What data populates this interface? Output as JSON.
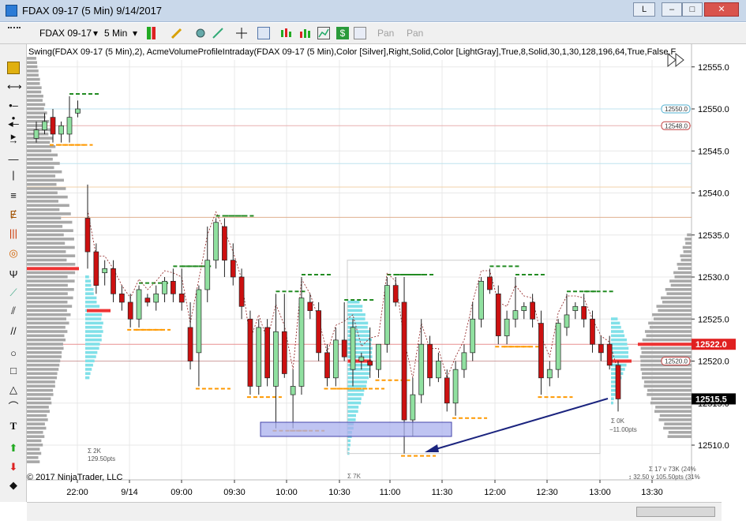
{
  "window": {
    "title": "FDAX 09-17 (5 Min)  9/14/2017",
    "btn_l": "L",
    "btn_min": "–",
    "btn_max": "□",
    "btn_close": "✕"
  },
  "toolbar": {
    "instrument": "FDAX 09-17",
    "period": "5 Min",
    "pan1": "Pan",
    "pan2": "Pan"
  },
  "chart_label": "Swing(FDAX 09-17 (5 Min),2), AcmeVolumeProfileIntraday(FDAX 09-17 (5 Min),Color [Silver],Right,Solid,Color [LightGray],True,8,Solid,30,1,30,128,196,64,True,False,F",
  "copyright": "© 2017 NinjaTrader, LLC",
  "annotations": {
    "mid_sigma": "Σ 7K",
    "left_sigma": "Σ 2K",
    "left_pts": "129.50pts",
    "right_sigma": "Σ 0K",
    "right_pts": "−11.00pts",
    "br_line1": "Σ 17 v 73K (24%",
    "br_line2": "↕ 32.50 v 105.50pts (31%"
  },
  "colors": {
    "up": "#90e0a0",
    "down": "#cc1010",
    "swing_high": "#228b22",
    "swing_low": "#ff9900",
    "profile": "#aaaaaa",
    "profile_cyan": "#80e0e8",
    "poc": "#ee3333",
    "arrow": "#1a237e",
    "box": "#aab0ee"
  },
  "chart_data": {
    "type": "candlestick",
    "instrument": "FDAX 09-17",
    "interval": "5 Min",
    "date": "9/14/2017",
    "y_ticks": [
      12510.0,
      12515.0,
      12520.0,
      12525.0,
      12530.0,
      12535.0,
      12540.0,
      12545.0,
      12550.0,
      12555.0
    ],
    "ylim": [
      12506.0,
      12557.0
    ],
    "x_ticks": [
      "22:00",
      "9/14",
      "09:00",
      "09:30",
      "10:00",
      "10:30",
      "11:00",
      "11:30",
      "12:00",
      "12:30",
      "13:00",
      "13:30"
    ],
    "price_markers": [
      {
        "label": "12550.0",
        "value": 12550.0,
        "color": "#50b0d0"
      },
      {
        "label": "12548.0",
        "value": 12548.0,
        "color": "#c04040"
      },
      {
        "label": "12522.0",
        "value": 12522.0,
        "color": "#e02020"
      },
      {
        "label": "12520.0",
        "value": 12520.0,
        "color": "#c04040"
      },
      {
        "label": "12515.5",
        "value": 12515.5,
        "color": "#000000"
      }
    ],
    "candles": [
      {
        "o": 12546.5,
        "h": 12548.5,
        "l": 12546.0,
        "c": 12547.5
      },
      {
        "o": 12547.5,
        "h": 12549.5,
        "l": 12547.0,
        "c": 12548.5
      },
      {
        "o": 12549.0,
        "h": 12550.0,
        "l": 12546.0,
        "c": 12547.0
      },
      {
        "o": 12547.0,
        "h": 12548.5,
        "l": 12546.0,
        "c": 12548.0
      },
      {
        "o": 12547.0,
        "h": 12551.5,
        "l": 12546.0,
        "c": 12549.0
      },
      {
        "o": 12549.5,
        "h": 12551.0,
        "l": 12549.0,
        "c": 12550.0
      },
      {
        "o": 12537.0,
        "h": 12541.0,
        "l": 12531.0,
        "c": 12533.0
      },
      {
        "o": 12533.0,
        "h": 12534.0,
        "l": 12528.0,
        "c": 12529.0
      },
      {
        "o": 12530.5,
        "h": 12532.0,
        "l": 12529.0,
        "c": 12531.0
      },
      {
        "o": 12531.0,
        "h": 12532.0,
        "l": 12527.0,
        "c": 12528.0
      },
      {
        "o": 12528.0,
        "h": 12529.0,
        "l": 12526.0,
        "c": 12527.0
      },
      {
        "o": 12527.0,
        "h": 12528.0,
        "l": 12524.0,
        "c": 12525.0
      },
      {
        "o": 12525.0,
        "h": 12529.0,
        "l": 12524.0,
        "c": 12528.5
      },
      {
        "o": 12527.5,
        "h": 12528.0,
        "l": 12526.5,
        "c": 12527.0
      },
      {
        "o": 12527.0,
        "h": 12529.0,
        "l": 12526.0,
        "c": 12528.0
      },
      {
        "o": 12528.0,
        "h": 12530.0,
        "l": 12527.0,
        "c": 12529.5
      },
      {
        "o": 12529.5,
        "h": 12531.0,
        "l": 12527.0,
        "c": 12528.0
      },
      {
        "o": 12528.0,
        "h": 12531.0,
        "l": 12526.0,
        "c": 12527.0
      },
      {
        "o": 12524.0,
        "h": 12527.0,
        "l": 12519.0,
        "c": 12520.0
      },
      {
        "o": 12521.0,
        "h": 12529.0,
        "l": 12517.0,
        "c": 12528.5
      },
      {
        "o": 12528.5,
        "h": 12536.0,
        "l": 12527.0,
        "c": 12532.0
      },
      {
        "o": 12532.0,
        "h": 12537.0,
        "l": 12531.0,
        "c": 12536.5
      },
      {
        "o": 12536.0,
        "h": 12537.0,
        "l": 12530.0,
        "c": 12532.0
      },
      {
        "o": 12532.0,
        "h": 12534.0,
        "l": 12529.0,
        "c": 12530.0
      },
      {
        "o": 12530.0,
        "h": 12531.0,
        "l": 12525.0,
        "c": 12526.5
      },
      {
        "o": 12525.0,
        "h": 12526.0,
        "l": 12516.0,
        "c": 12517.0
      },
      {
        "o": 12517.0,
        "h": 12525.0,
        "l": 12516.0,
        "c": 12524.0
      },
      {
        "o": 12524.0,
        "h": 12525.0,
        "l": 12517.0,
        "c": 12518.0
      },
      {
        "o": 12517.0,
        "h": 12528.0,
        "l": 12512.0,
        "c": 12523.5
      },
      {
        "o": 12523.5,
        "h": 12528.0,
        "l": 12518.0,
        "c": 12518.5
      },
      {
        "o": 12516.0,
        "h": 12519.0,
        "l": 12512.0,
        "c": 12517.0
      },
      {
        "o": 12517.0,
        "h": 12530.0,
        "l": 12516.0,
        "c": 12527.5
      },
      {
        "o": 12527.0,
        "h": 12528.0,
        "l": 12525.0,
        "c": 12526.0
      },
      {
        "o": 12526.0,
        "h": 12527.0,
        "l": 12520.0,
        "c": 12521.0
      },
      {
        "o": 12521.0,
        "h": 12522.0,
        "l": 12517.0,
        "c": 12518.0
      },
      {
        "o": 12518.0,
        "h": 12524.0,
        "l": 12517.0,
        "c": 12522.5
      },
      {
        "o": 12522.5,
        "h": 12527.0,
        "l": 12520.0,
        "c": 12520.5
      },
      {
        "o": 12519.0,
        "h": 12525.0,
        "l": 12517.0,
        "c": 12524.0
      },
      {
        "o": 12520.0,
        "h": 12521.0,
        "l": 12519.0,
        "c": 12520.5
      },
      {
        "o": 12520.0,
        "h": 12524.0,
        "l": 12518.0,
        "c": 12519.5
      },
      {
        "o": 12519.0,
        "h": 12522.0,
        "l": 12518.0,
        "c": 12522.0
      },
      {
        "o": 12522.0,
        "h": 12530.0,
        "l": 12521.0,
        "c": 12529.0
      },
      {
        "o": 12529.0,
        "h": 12530.0,
        "l": 12526.5,
        "c": 12527.0
      },
      {
        "o": 12527.0,
        "h": 12530.0,
        "l": 12509.0,
        "c": 12513.0
      },
      {
        "o": 12513.0,
        "h": 12518.0,
        "l": 12511.0,
        "c": 12516.0
      },
      {
        "o": 12516.0,
        "h": 12525.0,
        "l": 12515.0,
        "c": 12522.0
      },
      {
        "o": 12522.0,
        "h": 12523.0,
        "l": 12517.0,
        "c": 12518.0
      },
      {
        "o": 12518.0,
        "h": 12521.0,
        "l": 12517.5,
        "c": 12520.0
      },
      {
        "o": 12518.0,
        "h": 12519.0,
        "l": 12514.0,
        "c": 12515.0
      },
      {
        "o": 12515.0,
        "h": 12520.0,
        "l": 12513.5,
        "c": 12519.0
      },
      {
        "o": 12519.0,
        "h": 12522.0,
        "l": 12518.0,
        "c": 12521.0
      },
      {
        "o": 12521.0,
        "h": 12527.0,
        "l": 12520.0,
        "c": 12525.0
      },
      {
        "o": 12525.0,
        "h": 12530.0,
        "l": 12524.0,
        "c": 12529.5
      },
      {
        "o": 12530.0,
        "h": 12531.0,
        "l": 12528.0,
        "c": 12528.5
      },
      {
        "o": 12528.0,
        "h": 12529.0,
        "l": 12522.0,
        "c": 12523.0
      },
      {
        "o": 12523.0,
        "h": 12526.0,
        "l": 12522.0,
        "c": 12525.0
      },
      {
        "o": 12525.0,
        "h": 12530.0,
        "l": 12524.0,
        "c": 12526.0
      },
      {
        "o": 12526.0,
        "h": 12527.0,
        "l": 12525.0,
        "c": 12526.5
      },
      {
        "o": 12527.0,
        "h": 12528.0,
        "l": 12524.0,
        "c": 12525.0
      },
      {
        "o": 12524.5,
        "h": 12526.0,
        "l": 12516.0,
        "c": 12518.0
      },
      {
        "o": 12518.0,
        "h": 12520.0,
        "l": 12517.0,
        "c": 12519.0
      },
      {
        "o": 12519.0,
        "h": 12525.0,
        "l": 12518.0,
        "c": 12524.5
      },
      {
        "o": 12524.0,
        "h": 12528.0,
        "l": 12523.0,
        "c": 12525.5
      },
      {
        "o": 12526.0,
        "h": 12527.0,
        "l": 12525.0,
        "c": 12526.5
      },
      {
        "o": 12526.5,
        "h": 12528.0,
        "l": 12524.0,
        "c": 12525.0
      },
      {
        "o": 12525.0,
        "h": 12526.0,
        "l": 12521.0,
        "c": 12522.0
      },
      {
        "o": 12522.0,
        "h": 12523.0,
        "l": 12520.0,
        "c": 12521.0
      },
      {
        "o": 12522.0,
        "h": 12523.0,
        "l": 12519.0,
        "c": 12519.5
      },
      {
        "o": 12519.5,
        "h": 12520.0,
        "l": 12514.0,
        "c": 12515.5
      }
    ]
  }
}
